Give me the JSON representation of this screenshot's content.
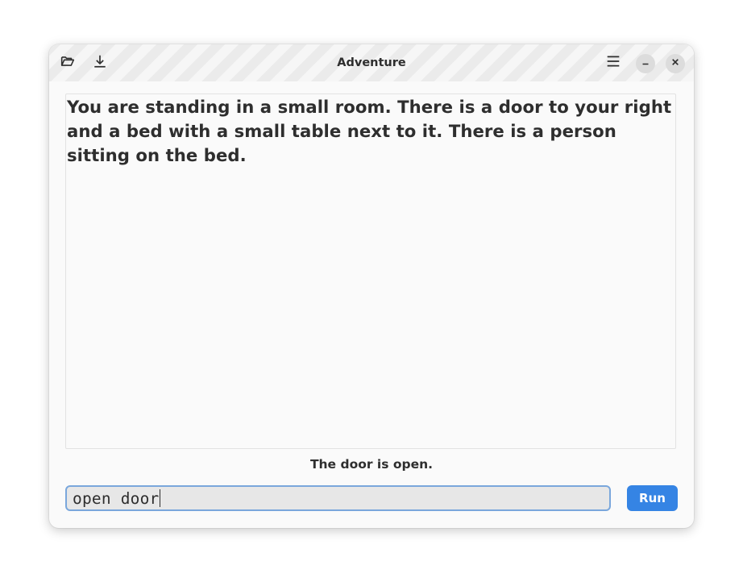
{
  "window": {
    "title": "Adventure"
  },
  "header": {
    "open_icon": "folder-open-icon",
    "save_icon": "download-icon",
    "menu_icon": "hamburger-menu-icon",
    "minimize_icon": "minimize-icon",
    "close_icon": "close-icon"
  },
  "story": {
    "text": "You are standing in a small room. There is a door to your right and a bed with a small table next to it. There is a person sitting on the bed."
  },
  "status": {
    "text": "The door is open."
  },
  "command": {
    "value": "open door",
    "run_label": "Run"
  },
  "colors": {
    "accent": "#3584e4",
    "focus_ring": "#7aa7dc",
    "text": "#2e2e2e",
    "background": "#fafafa"
  }
}
